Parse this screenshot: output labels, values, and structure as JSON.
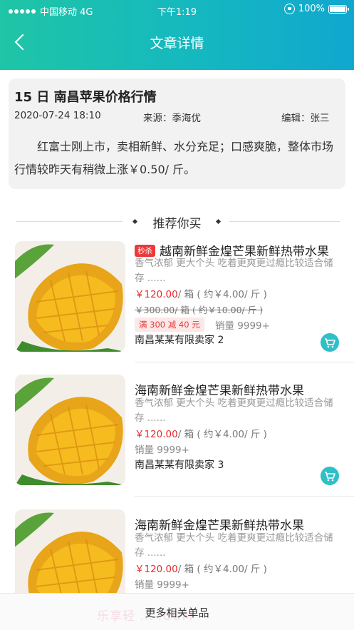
{
  "status_bar": {
    "carrier": "中国移动 4G",
    "time": "下午1:19",
    "battery": "100%"
  },
  "header": {
    "title": "文章详情"
  },
  "article": {
    "title": "15 日 南昌苹果价格行情",
    "date": "2020-07-24 18:10",
    "source": "来源：季海优",
    "editor": "编辑：张三",
    "body": "红富士刚上市，卖相新鲜、水分充足；口感爽脆，整体市场行情较昨天有稍微上涨￥0.50/ 斤。"
  },
  "recommend": {
    "title": "推荐你买"
  },
  "products": [
    {
      "tag": "秒杀",
      "name": "越南新鲜金煌芒果新鲜热带水果",
      "desc": "香气浓郁 更大个头 吃着更爽更过瘾比较适合储存 ......",
      "price": "￥120.00",
      "price_unit": "/ 箱 ( 约￥4.00/ 斤 )",
      "old_price": "￥300.00/ 箱 ( 约￥10.00/ 斤 )",
      "coupon": "满 300 减 40 元",
      "sales": "销量 9999+",
      "seller": "南昌某某有限卖家 2"
    },
    {
      "name": "海南新鲜金煌芒果新鲜热带水果",
      "desc": "香气浓郁 更大个头 吃着更爽更过瘾比较适合储存 ......",
      "price": "￥120.00",
      "price_unit": "/ 箱 ( 约￥4.00/ 斤 )",
      "sales": "销量 9999+",
      "seller": "南昌某某有限卖家 3"
    },
    {
      "name": "海南新鲜金煌芒果新鲜热带水果",
      "desc": "香气浓郁 更大个头 吃着更爽更过瘾比较适合储存 ......",
      "price": "￥120.00",
      "price_unit": "/ 箱 ( 约￥4.00/ 斤 )",
      "sales": "销量 9999+"
    }
  ],
  "footer": {
    "more": "更多相关单品",
    "watermark": "乐享轻  ...  .COM"
  },
  "icons": {
    "back": "chevron-left-icon",
    "cart": "shopping-cart-icon",
    "lock": "rotation-lock-icon"
  },
  "colors": {
    "header_start": "#1fc5a6",
    "header_end": "#10a7cf",
    "price_red": "#e62b2b",
    "cart_teal": "#2fbfc7"
  }
}
